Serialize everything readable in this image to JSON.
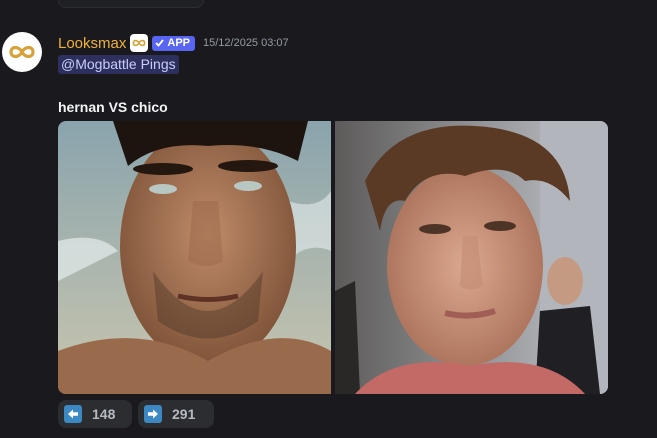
{
  "message": {
    "author": "Looksmax",
    "app_badge": "APP",
    "timestamp": "15/12/2025 03:07",
    "mention": "@Mogbattle Pings",
    "title": "hernan VS chico"
  },
  "images": [
    {
      "name": "hernan"
    },
    {
      "name": "chico"
    }
  ],
  "reactions": [
    {
      "icon": "left-arrow-icon",
      "count": "148"
    },
    {
      "icon": "right-arrow-icon",
      "count": "291"
    }
  ],
  "colors": {
    "background": "#1a1a1e",
    "username": "#f0b232",
    "app_badge": "#5865f2",
    "mention_bg": "rgba(88,101,242,0.3)",
    "arrow_box": "#3b88c3"
  }
}
